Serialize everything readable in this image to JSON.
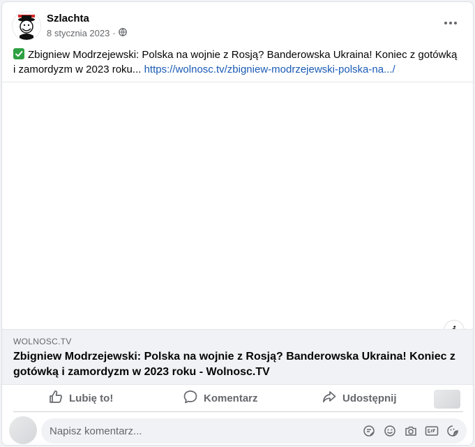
{
  "post": {
    "author": "Szlachta",
    "date": "8 stycznia 2023",
    "separator": "·",
    "text": "Zbigniew Modrzejewski: Polska na wojnie z Rosją? Banderowska Ukraina! Koniec z gotówką i zamordyzm w 2023 roku...",
    "link_text": "https://wolnosc.tv/zbigniew-modrzejewski-polska-na.../"
  },
  "preview": {
    "domain": "WOLNOSC.TV",
    "title": "Zbigniew Modrzejewski: Polska na wojnie z Rosją? Banderowska Ukraina! Koniec z gotówką i zamordyzm w 2023 roku - Wolnosc.TV",
    "info_label": "i"
  },
  "actions": {
    "like": "Lubię to!",
    "comment": "Komentarz",
    "share": "Udostępnij"
  },
  "comment": {
    "placeholder": "Napisz komentarz..."
  },
  "icons": {
    "globe": "globe-icon",
    "more": "more-options-icon",
    "check": "check-mark-icon",
    "like": "thumbs-up-icon",
    "comment": "speech-bubble-icon",
    "share": "share-arrow-icon",
    "avatar_sticker": "sticker-icon",
    "emoji": "emoji-icon",
    "camera": "camera-icon",
    "gif": "gif-icon",
    "sticker": "sticker-face-icon"
  },
  "colors": {
    "link": "#1a5bb5",
    "check": "#2ea043",
    "secondary_text": "#65676b"
  }
}
